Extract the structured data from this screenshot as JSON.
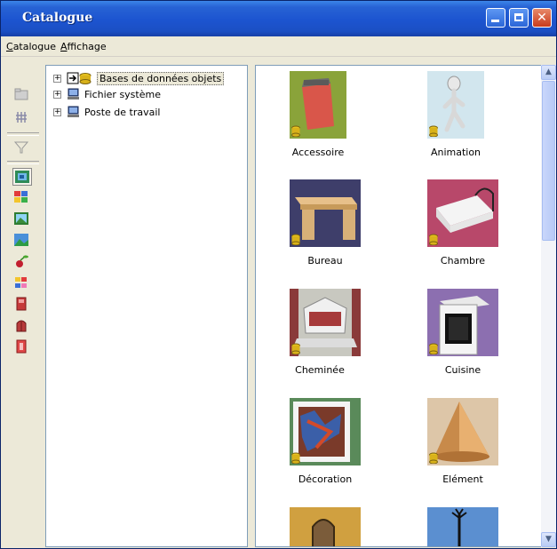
{
  "window": {
    "title": "Catalogue"
  },
  "menu": {
    "items": [
      {
        "first": "C",
        "rest": "atalogue"
      },
      {
        "first": "A",
        "rest": "ffichage"
      }
    ]
  },
  "toolbar": {
    "tools": [
      "folder-icon",
      "grid-icon",
      "filter-icon",
      "catalog-view-icon",
      "color-tiles-icon",
      "image-icon",
      "landscape-icon",
      "cherry-icon",
      "palette-icon",
      "door-icon",
      "arch-door-icon",
      "red-door-icon"
    ]
  },
  "tree": {
    "items": [
      {
        "label": "Bases de données objets",
        "expander": "+"
      },
      {
        "label": "Fichier système",
        "expander": "+"
      },
      {
        "label": "Poste de travail",
        "expander": "+"
      }
    ]
  },
  "catalog": {
    "items": [
      {
        "label": "Accessoire",
        "icon": "accessory-thumbnail"
      },
      {
        "label": "Animation",
        "icon": "animation-thumbnail"
      },
      {
        "label": "Bureau",
        "icon": "desk-thumbnail"
      },
      {
        "label": "Chambre",
        "icon": "bed-thumbnail"
      },
      {
        "label": "Cheminée",
        "icon": "fireplace-thumbnail"
      },
      {
        "label": "Cuisine",
        "icon": "oven-thumbnail"
      },
      {
        "label": "Décoration",
        "icon": "painting-thumbnail"
      },
      {
        "label": "Elément",
        "icon": "cone-thumbnail"
      }
    ]
  },
  "colors": {
    "titlebar": "#2762d4",
    "selection": "#ece9d8"
  }
}
